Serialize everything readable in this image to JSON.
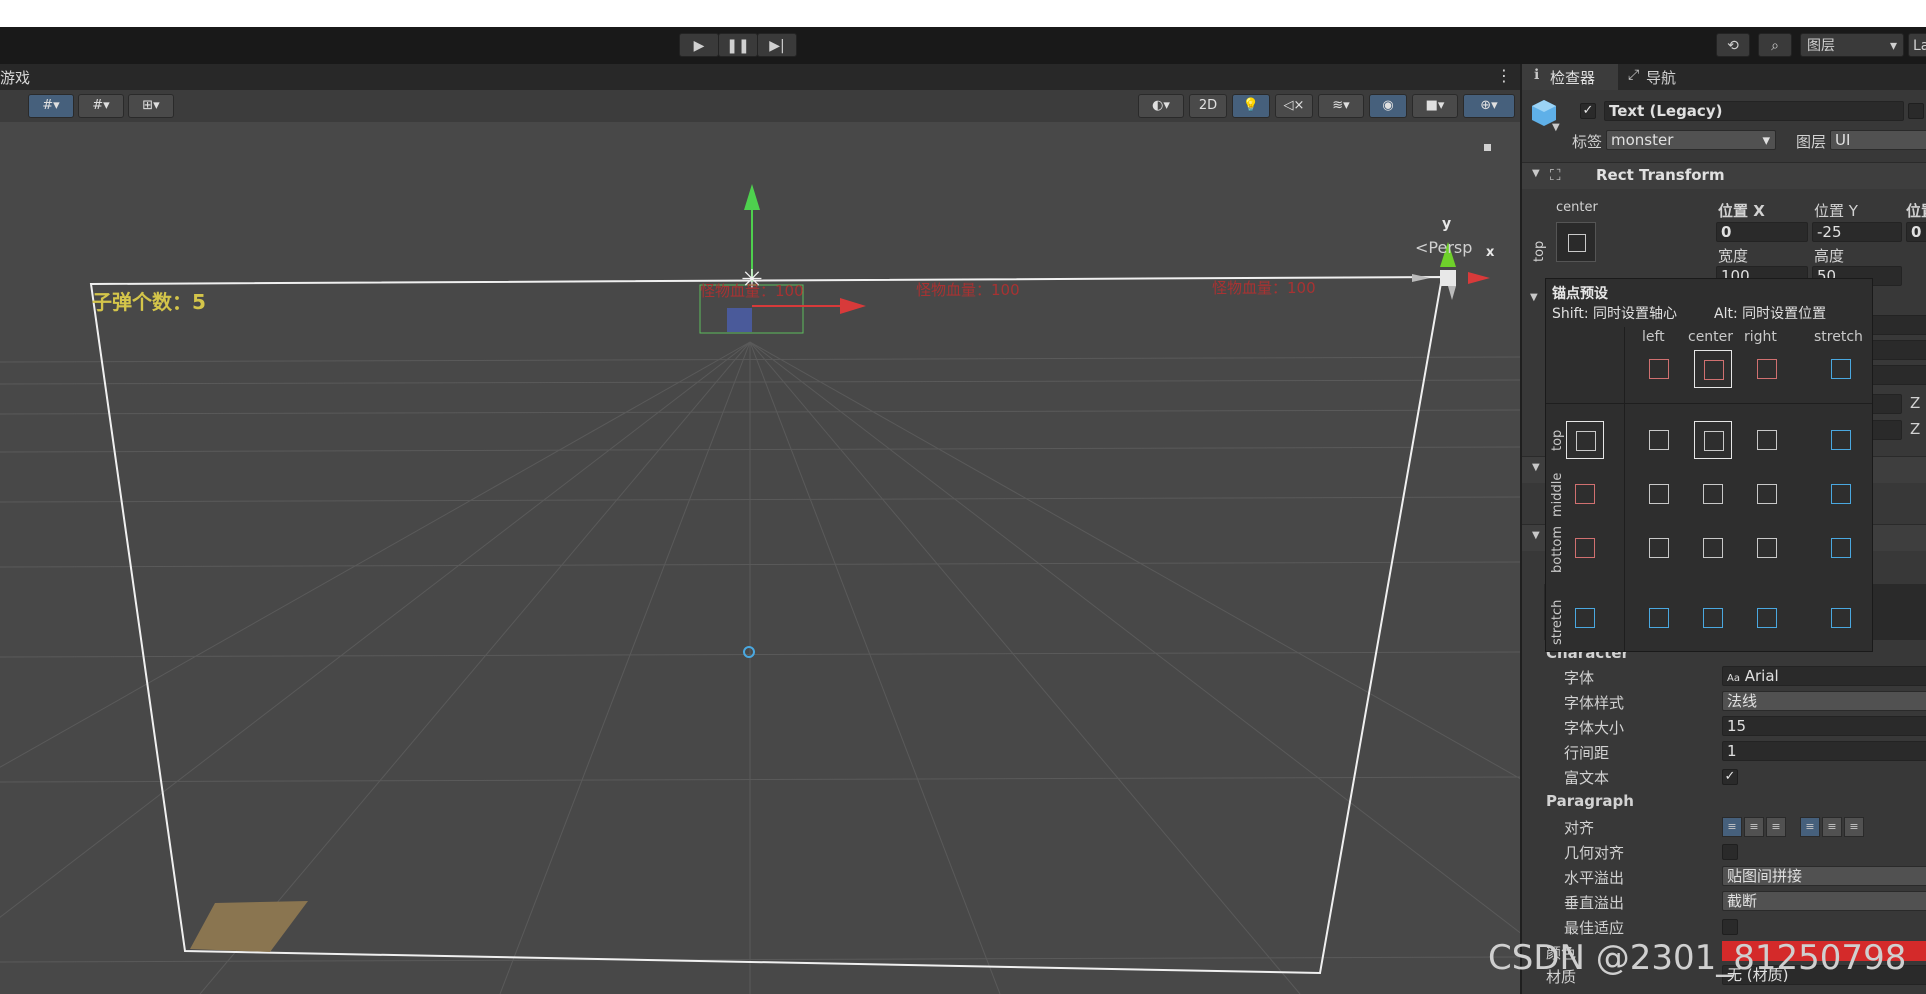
{
  "toolbar": {
    "play_icon": "play-icon",
    "pause_icon": "pause-icon",
    "step_icon": "step-icon",
    "history_icon": "history-icon",
    "search_icon": "search-icon",
    "layers_dropdown": "图层",
    "layout_dropdown": "La"
  },
  "scene": {
    "tab_label": "游戏",
    "toggle_2d": "2D",
    "persp_label": "<Persp",
    "gizmo_y": "y",
    "gizmo_x": "x",
    "bullet_text": "子弹个数：5",
    "monster_hp": [
      "怪物血量：100",
      "怪物血量：100",
      "怪物血量：100"
    ]
  },
  "inspector": {
    "tab_inspector": "检查器",
    "tab_navigation": "导航",
    "object_name": "Text (Legacy)",
    "active_checked": true,
    "tag_label": "标签",
    "tag_value": "monster",
    "layer_label": "图层",
    "layer_value": "UI",
    "rect_transform_title": "Rect Transform",
    "anchor_h": "center",
    "anchor_v": "top",
    "pos_x_label": "位置 X",
    "pos_y_label": "位置 Y",
    "pos_z_label": "位置",
    "pos_x": "0",
    "pos_y": "-25",
    "pos_z": "0",
    "width_label": "宽度",
    "height_label": "高度",
    "width": "100",
    "height": "50",
    "z_label_1": "Z",
    "z_label_2": "Z",
    "character_header": "Character",
    "font_label": "字体",
    "font_value": "Arial",
    "font_prefix": "Aa",
    "font_style_label": "字体样式",
    "font_style_value": "法线",
    "font_size_label": "字体大小",
    "font_size_value": "15",
    "line_spacing_label": "行间距",
    "line_spacing_value": "1",
    "rich_text_label": "富文本",
    "rich_text_checked": true,
    "paragraph_header": "Paragraph",
    "alignment_label": "对齐",
    "align_by_geometry_label": "几何对齐",
    "horizontal_overflow_label": "水平溢出",
    "horizontal_overflow_value": "贴图间拼接",
    "vertical_overflow_label": "垂直溢出",
    "vertical_overflow_value": "截断",
    "best_fit_label": "最佳适应",
    "color_label": "颜色",
    "color_value": "#d42a2a",
    "material_label": "材质",
    "material_value": "无 (材质)"
  },
  "anchor_popup": {
    "title": "锚点预设",
    "shift_hint": "Shift:  同时设置轴心",
    "alt_hint": "Alt:  同时设置位置",
    "columns": [
      "left",
      "center",
      "right",
      "stretch"
    ],
    "rows": [
      "top",
      "middle",
      "bottom",
      "stretch"
    ]
  },
  "watermark": "CSDN @2301_81250798",
  "colors": {
    "accent": "#46607c",
    "hp_text": "#c0392b",
    "bullet_text": "#d4c54a"
  }
}
